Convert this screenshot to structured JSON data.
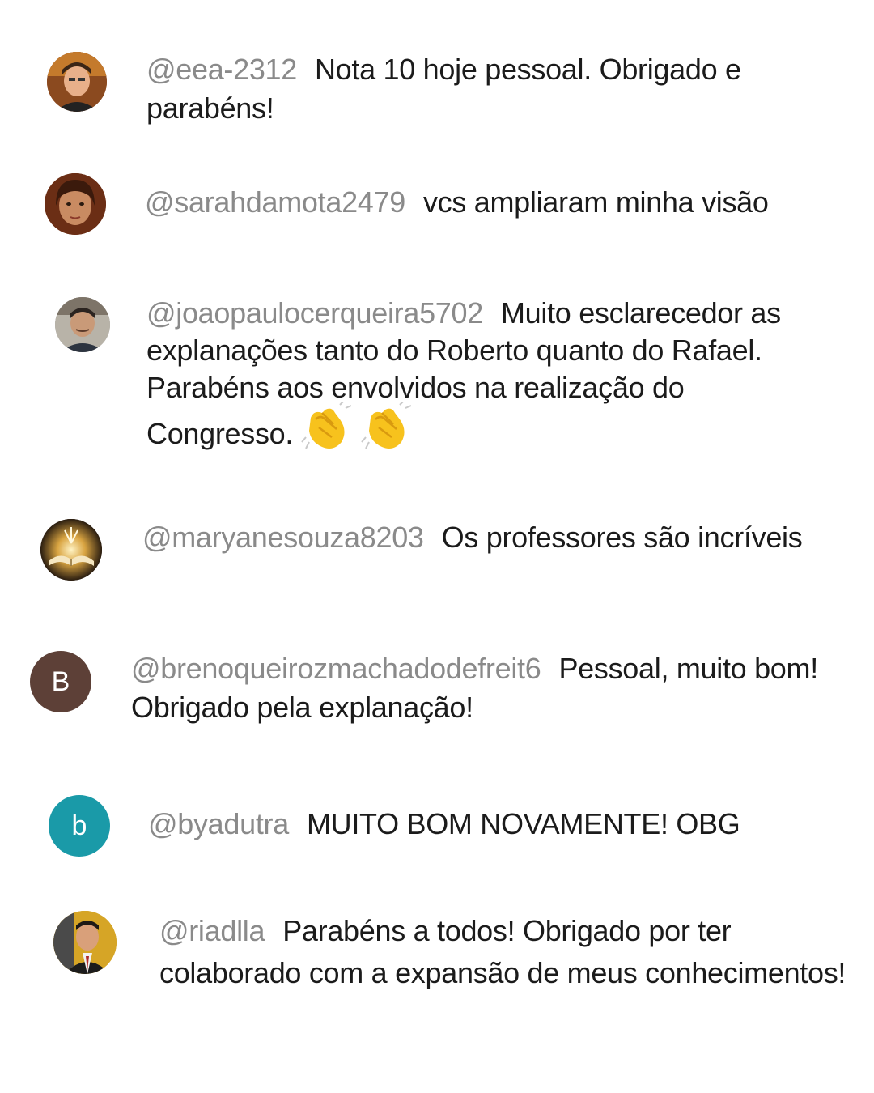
{
  "comments": [
    {
      "handle": "@eea-2312",
      "text": "Nota 10 hoje pessoal. Obrigado e parabéns!",
      "avatar_type": "photo",
      "avatar_icon": "user-photo-icon"
    },
    {
      "handle": "@sarahdamota2479",
      "text": "vcs ampliaram minha visão",
      "avatar_type": "photo",
      "avatar_icon": "user-photo-icon"
    },
    {
      "handle": "@joaopaulocerqueira5702",
      "text": "Muito esclarecedor as explanações tanto do Roberto quanto do Rafael. Parabéns aos envolvidos na realização do Congresso.",
      "emoji_icons": [
        "clapping-hands-icon",
        "clapping-hands-icon"
      ],
      "avatar_type": "photo",
      "avatar_icon": "user-photo-icon"
    },
    {
      "handle": "@maryanesouza8203",
      "text": "Os professores são incríveis",
      "avatar_type": "photo",
      "avatar_icon": "open-book-photo-icon"
    },
    {
      "handle": "@brenoqueirozmachadodefreit6",
      "text": "Pessoal, muito bom! Obrigado pela explanação!",
      "avatar_type": "letter",
      "avatar_letter": "B",
      "avatar_color": "#5d4037"
    },
    {
      "handle": "@byadutra",
      "text": "MUITO BOM NOVAMENTE! OBG",
      "avatar_type": "letter",
      "avatar_letter": "b",
      "avatar_color": "#1a9aa8"
    },
    {
      "handle": "@riadlla",
      "text": "Parabéns a todos! Obrigado por ter colaborado com a expansão de meus conhecimentos!",
      "avatar_type": "photo",
      "avatar_icon": "user-photo-icon"
    }
  ],
  "colors": {
    "handle": "#8a8a8a",
    "text": "#1b1b1b",
    "background": "#ffffff"
  }
}
